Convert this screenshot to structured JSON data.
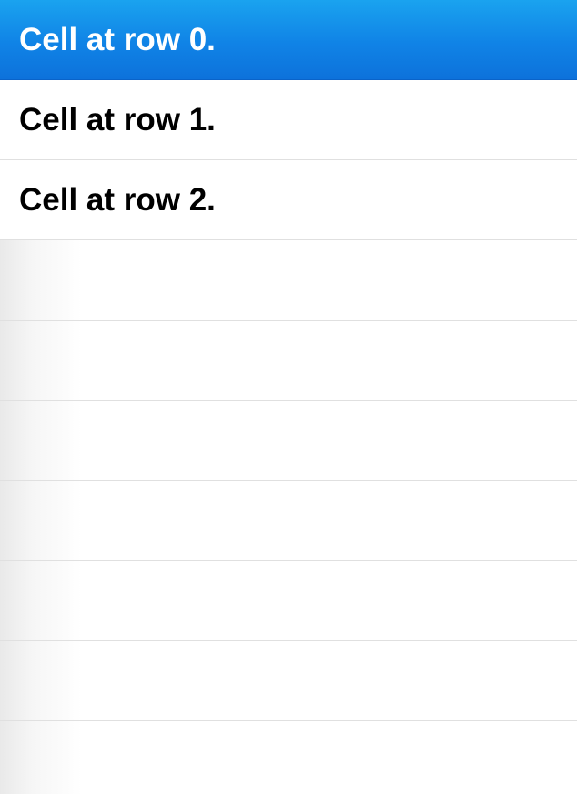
{
  "table": {
    "rows": [
      {
        "label": "Cell at row 0.",
        "selected": true
      },
      {
        "label": "Cell at row 1.",
        "selected": false
      },
      {
        "label": "Cell at row 2.",
        "selected": false
      }
    ],
    "empty_row_count": 7
  },
  "colors": {
    "selection_top": "#1aa3ef",
    "selection_bottom": "#0d72db",
    "separator": "#e0e0e0",
    "text": "#000000",
    "selected_text": "#ffffff"
  }
}
